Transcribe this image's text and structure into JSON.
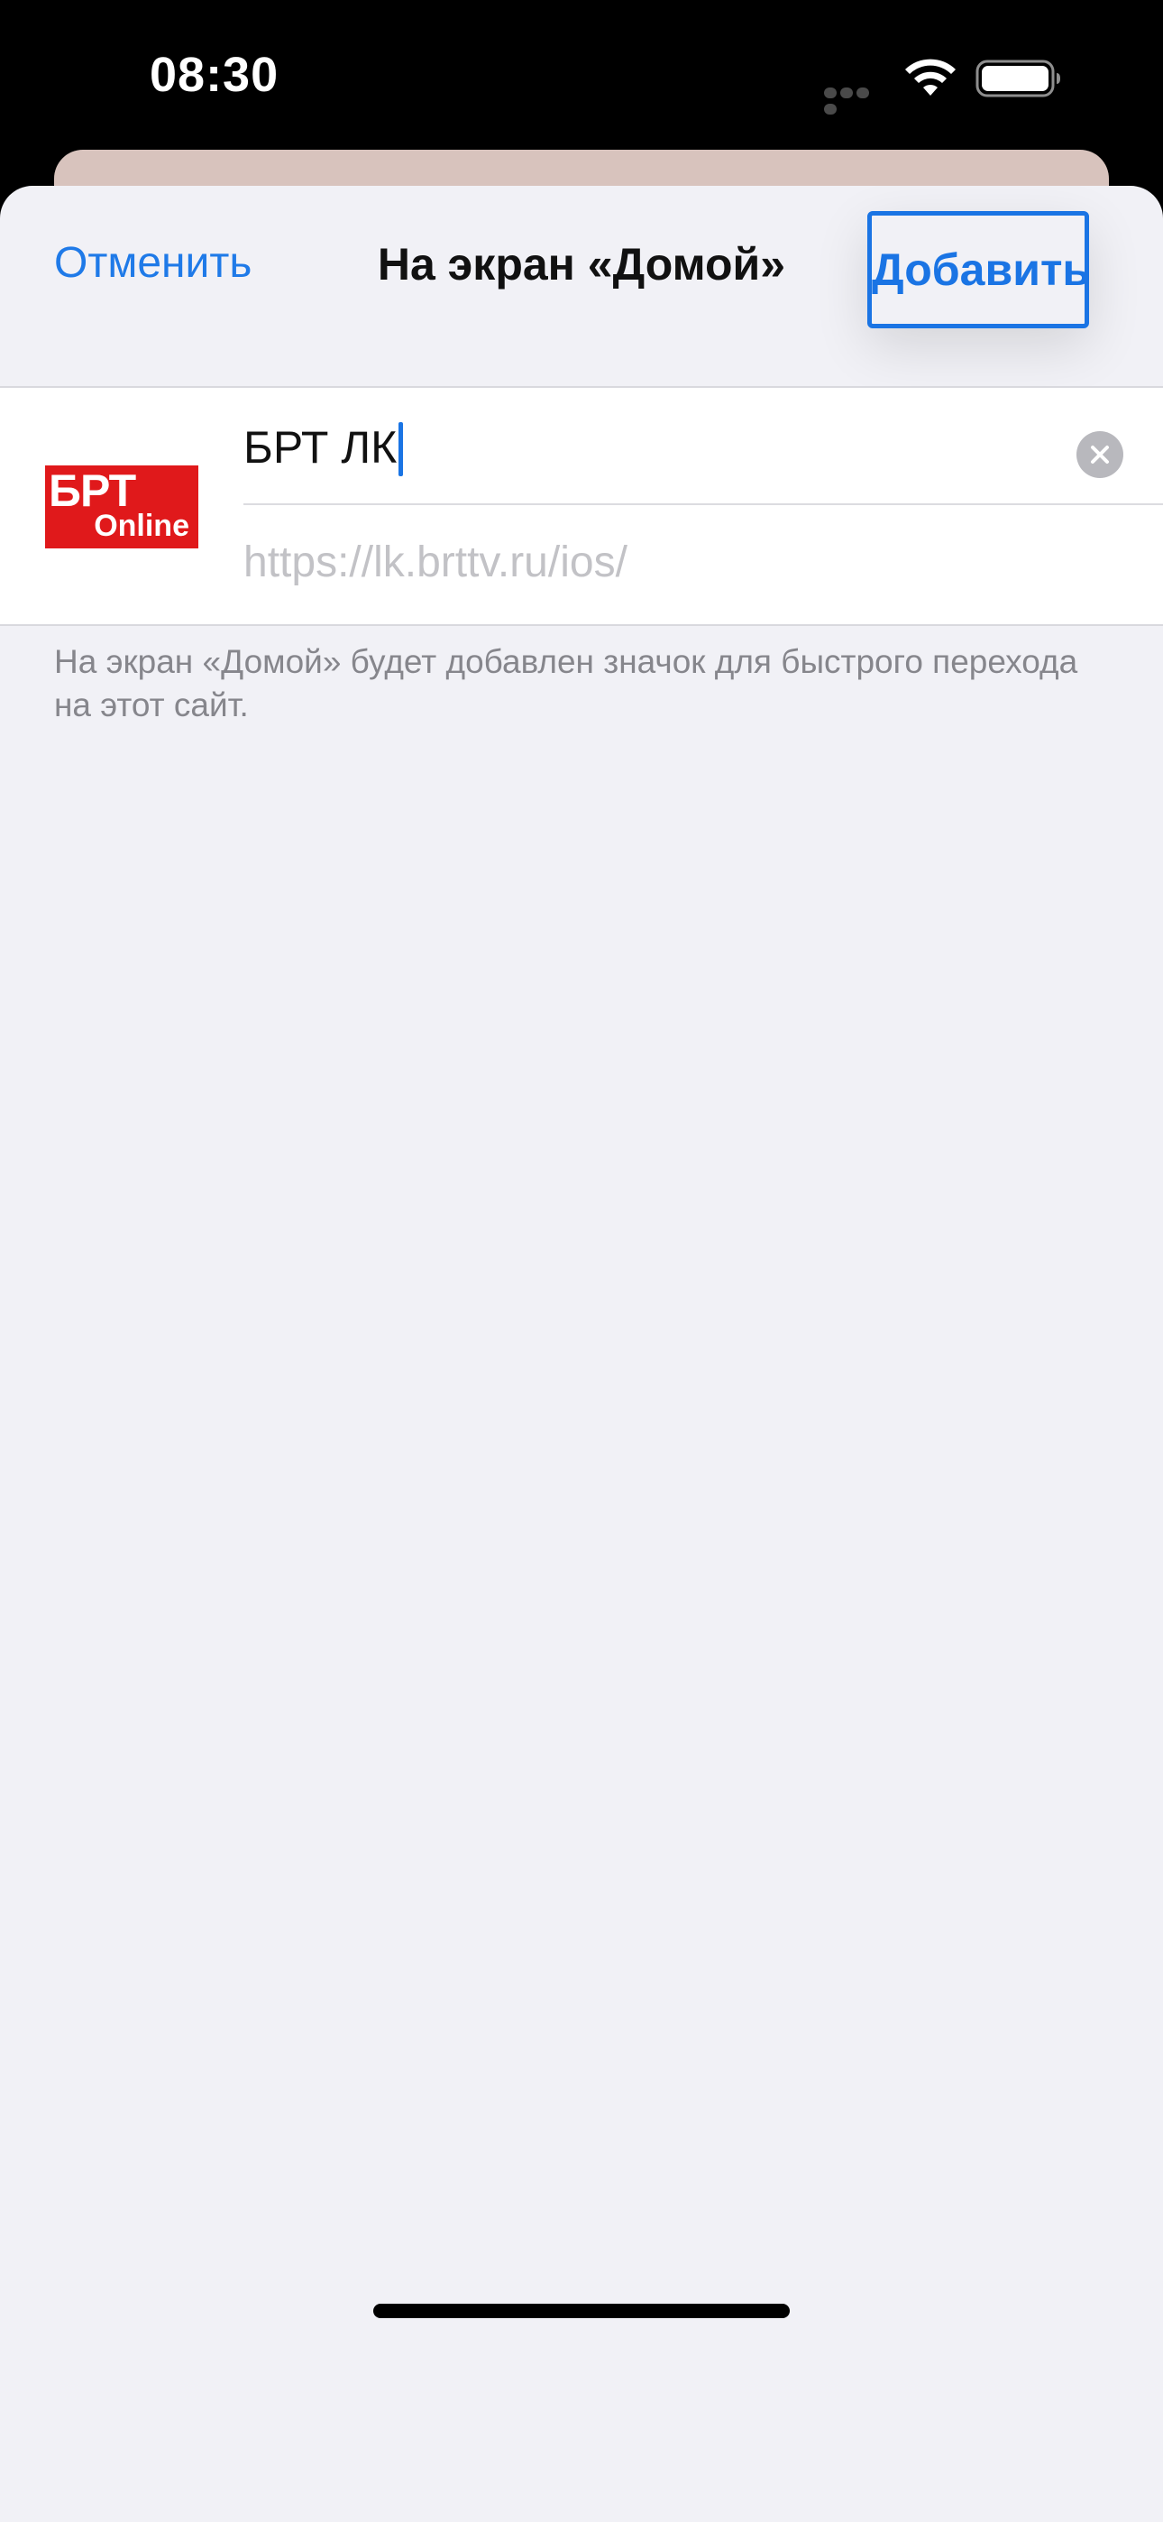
{
  "status_bar": {
    "time": "08:30"
  },
  "nav": {
    "cancel_label": "Отменить",
    "title": "На экран «Домой»",
    "add_label": "Добавить"
  },
  "bookmark": {
    "icon": {
      "line1": "БРТ",
      "line2": "Online",
      "background_color": "#e0191b"
    },
    "name_value": "БРТ ЛК",
    "url": "https://lk.brttv.ru/ios/"
  },
  "footer_note": "На экран «Домой» будет добавлен значок для быстрого перехода на этот сайт.",
  "colors": {
    "accent": "#1a74e4",
    "sheet_background": "#f1f1f6",
    "secondary_text": "#86868c"
  },
  "icons": {
    "wifi": "wifi-icon",
    "battery": "battery-icon",
    "clear": "clear-text-icon",
    "signal": "cellular-signal-icon"
  }
}
